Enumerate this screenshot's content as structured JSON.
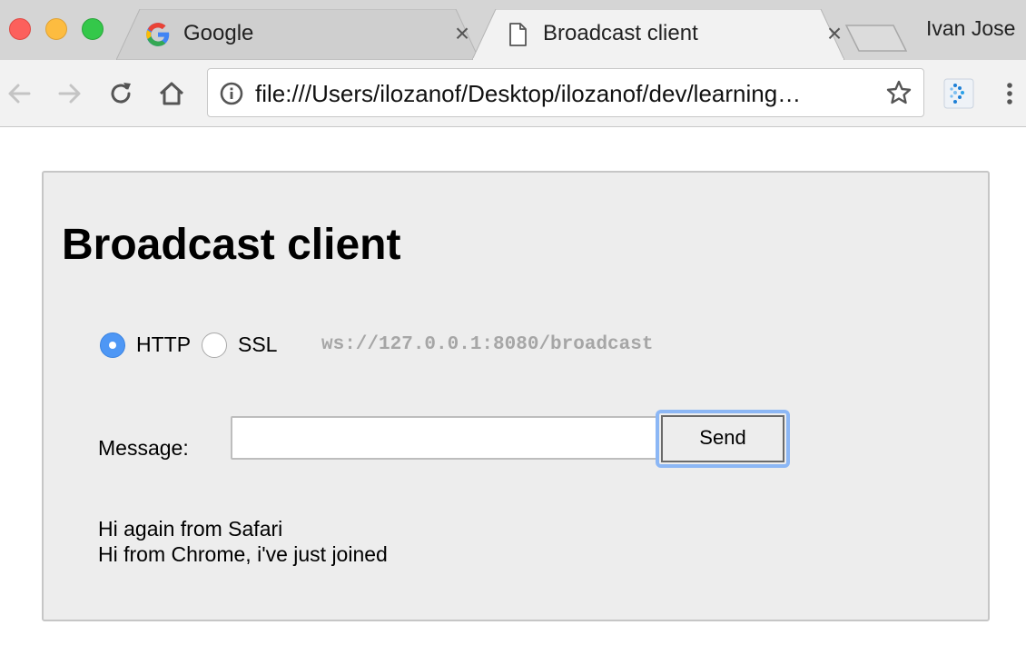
{
  "browser": {
    "tabs": [
      {
        "title": "Google",
        "favicon": "google-g-icon"
      },
      {
        "title": "Broadcast client",
        "favicon": "document-icon"
      }
    ],
    "profile_name": "Ivan Jose",
    "address": "file:///Users/ilozanof/Desktop/ilozanof/dev/learning…"
  },
  "page": {
    "title": "Broadcast client",
    "protocol": {
      "options": [
        {
          "label": "HTTP",
          "selected": true
        },
        {
          "label": "SSL",
          "selected": false
        }
      ],
      "endpoint": "ws://127.0.0.1:8080/broadcast"
    },
    "message_label": "Message:",
    "message_value": "",
    "send_label": "Send",
    "messages": [
      "Hi again from Safari",
      "Hi from Chrome, i've just joined"
    ]
  },
  "colors": {
    "accent": "#4e97f5",
    "focus_ring": "#8cb7f5",
    "panel": "#ededed",
    "endpoint_text": "#a6a6a6"
  }
}
